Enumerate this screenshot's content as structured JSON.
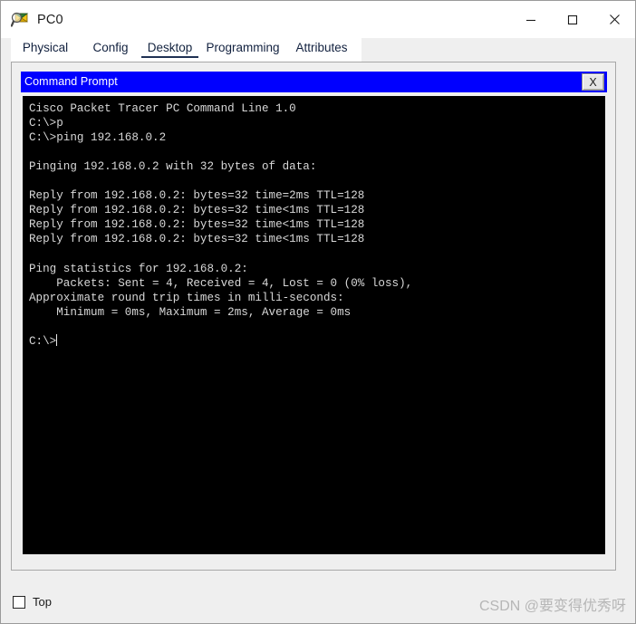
{
  "window": {
    "title": "PC0",
    "icon": "packet-tracer-pc-icon",
    "controls": {
      "minimize": "minimize-icon",
      "maximize": "maximize-icon",
      "close": "close-icon"
    }
  },
  "tabs": [
    {
      "label": "Physical",
      "active": false
    },
    {
      "label": "Config",
      "active": false
    },
    {
      "label": "Desktop",
      "active": true
    },
    {
      "label": "Programming",
      "active": false
    },
    {
      "label": "Attributes",
      "active": false
    }
  ],
  "command_prompt": {
    "title": "Command Prompt",
    "close_label": "X",
    "titlebar_color": "#0000FF",
    "screen_background": "#000000",
    "text_color": "#D8D8D8",
    "lines": [
      "Cisco Packet Tracer PC Command Line 1.0",
      "C:\\>p",
      "C:\\>ping 192.168.0.2",
      "",
      "Pinging 192.168.0.2 with 32 bytes of data:",
      "",
      "Reply from 192.168.0.2: bytes=32 time=2ms TTL=128",
      "Reply from 192.168.0.2: bytes=32 time<1ms TTL=128",
      "Reply from 192.168.0.2: bytes=32 time<1ms TTL=128",
      "Reply from 192.168.0.2: bytes=32 time<1ms TTL=128",
      "",
      "Ping statistics for 192.168.0.2:",
      "    Packets: Sent = 4, Received = 4, Lost = 0 (0% loss),",
      "Approximate round trip times in milli-seconds:",
      "    Minimum = 0ms, Maximum = 2ms, Average = 0ms",
      "",
      "C:\\>"
    ],
    "prompt": "C:\\>"
  },
  "bottom": {
    "top_checkbox_label": "Top",
    "top_checkbox_checked": false
  },
  "watermark": "CSDN @要变得优秀呀"
}
